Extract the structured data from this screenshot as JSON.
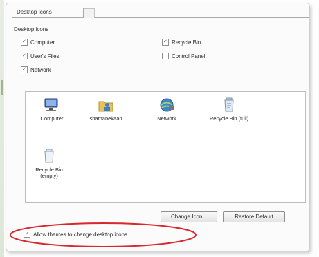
{
  "tab": {
    "label": "Desktop Icons"
  },
  "group": {
    "title": "Desktop icons"
  },
  "checkboxes": [
    {
      "label": "Computer",
      "checked": true
    },
    {
      "label": "Recycle Bin",
      "checked": true
    },
    {
      "label": "User's Files",
      "checked": true
    },
    {
      "label": "Control Panel",
      "checked": false
    },
    {
      "label": "Network",
      "checked": true
    }
  ],
  "icons": [
    {
      "label": "Computer",
      "icon": "computer-icon"
    },
    {
      "label": "shamanekaan",
      "icon": "user-folder-icon"
    },
    {
      "label": "Network",
      "icon": "network-icon"
    },
    {
      "label": "Recycle Bin (full)",
      "icon": "recycle-bin-full-icon"
    },
    {
      "label": "Recycle Bin (empty)",
      "icon": "recycle-bin-empty-icon"
    }
  ],
  "buttons": {
    "change_icon": "Change Icon...",
    "restore_default": "Restore Default"
  },
  "allow_themes": {
    "label": "Allow themes to change desktop icons",
    "checked": true
  },
  "colors": {
    "highlight": "#d7282f",
    "check": "#3a5a9a"
  }
}
